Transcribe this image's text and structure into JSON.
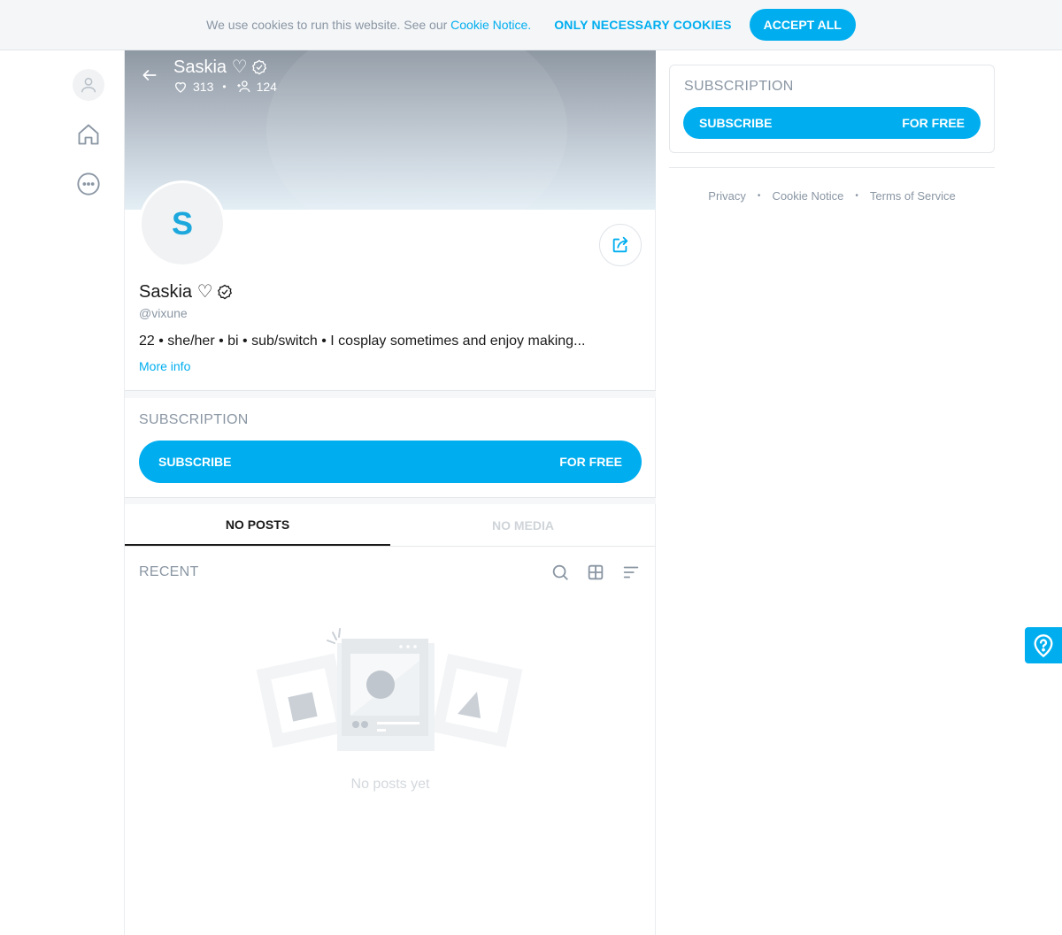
{
  "cookie": {
    "text": "We use cookies to run this website. See our ",
    "link": "Cookie Notice.",
    "necessary": "ONLY NECESSARY COOKIES",
    "accept": "ACCEPT ALL"
  },
  "profile": {
    "name": "Saskia ♡",
    "likes": "313",
    "fans": "124",
    "avatar_initial": "S",
    "handle": "@vixune",
    "bio": "22 • she/her • bi • sub/switch • I cosplay sometimes and enjoy making...",
    "more_info": "More info"
  },
  "subscription": {
    "title": "SUBSCRIPTION",
    "button_left": "SUBSCRIBE",
    "button_right": "FOR FREE"
  },
  "tabs": [
    {
      "label": "NO POSTS",
      "active": true
    },
    {
      "label": "NO MEDIA",
      "active": false
    }
  ],
  "feed": {
    "recent_label": "RECENT",
    "empty_text": "No posts yet"
  },
  "footer": {
    "links": [
      "Privacy",
      "Cookie Notice",
      "Terms of Service"
    ]
  },
  "colors": {
    "accent": "#00aeef",
    "muted": "#8a96a3"
  }
}
